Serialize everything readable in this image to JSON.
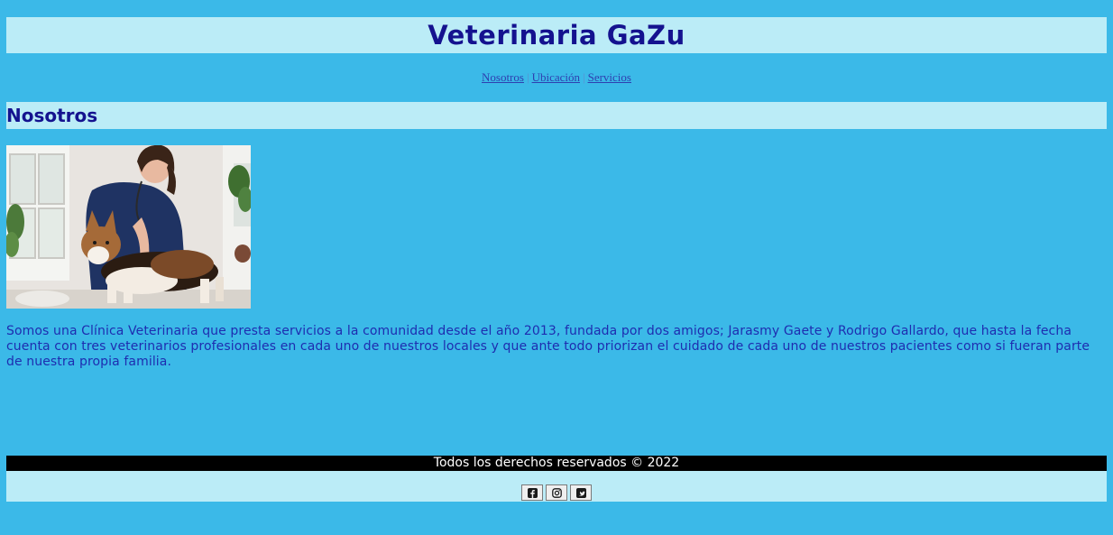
{
  "header": {
    "title": "Veterinaria GaZu"
  },
  "nav": {
    "items": [
      {
        "label": "Nosotros"
      },
      {
        "label": "Ubicación"
      },
      {
        "label": "Servicios"
      }
    ],
    "separator": "|"
  },
  "section": {
    "title": "Nosotros",
    "image_icon": "vet-with-dog-photo",
    "text": "Somos una Clínica Veterinaria que presta servicios a la comunidad desde el año 2013, fundada por dos amigos; Jarasmy Gaete y Rodrigo Gallardo, que hasta la fecha cuenta con tres veterinarios profesionales en cada uno de nuestros locales y que ante todo priorizan el cuidado de cada uno de nuestros pacientes como si fueran parte de nuestra propia familia."
  },
  "footer": {
    "copyright": "Todos los derechos reservados © 2022",
    "social": [
      {
        "icon": "facebook-icon"
      },
      {
        "icon": "instagram-icon"
      },
      {
        "icon": "twitter-icon"
      }
    ]
  },
  "colors": {
    "page_background": "#3bb9e8",
    "bar_background": "#bbecf7",
    "heading": "#14128f",
    "body_text": "#1e2db0",
    "footer_bar": "#000000"
  }
}
